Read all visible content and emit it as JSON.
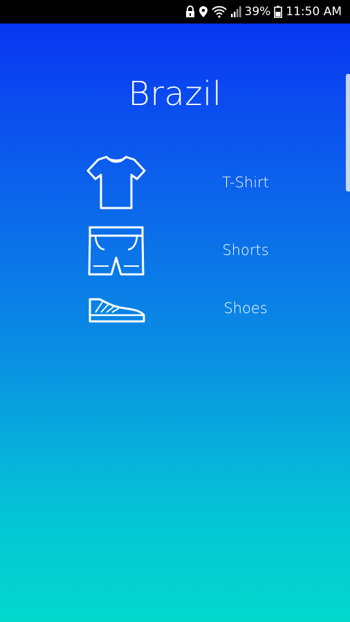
{
  "status_bar": {
    "battery_percent": "39%",
    "time": "11:50 AM",
    "icons": [
      "lock-icon",
      "location-icon",
      "wifi-icon",
      "signal-icon",
      "battery-icon"
    ]
  },
  "page": {
    "title": "Brazil"
  },
  "items": [
    {
      "label": "T-Shirt",
      "icon": "tshirt-icon"
    },
    {
      "label": "Shorts",
      "icon": "shorts-icon"
    },
    {
      "label": "Shoes",
      "icon": "shoe-icon"
    }
  ],
  "colors": {
    "gradient_top": "#0830f2",
    "gradient_bottom": "#03d8cb",
    "text": "#ffffff"
  }
}
